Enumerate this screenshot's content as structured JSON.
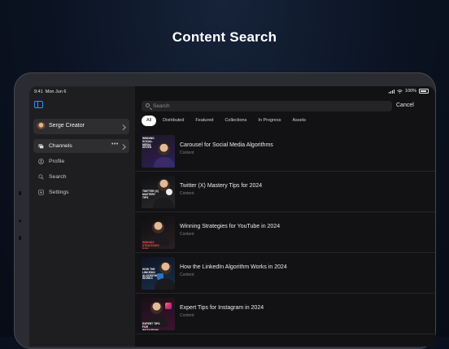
{
  "headline": "Content Search",
  "status_bar": {
    "time": "9:41",
    "date": "Mon Jun 6",
    "battery": "100%"
  },
  "sidebar": {
    "account": {
      "name": "Serge Creator"
    },
    "items": [
      {
        "label": "Channels",
        "icon": "folders-icon",
        "active": true,
        "more": "•••"
      },
      {
        "label": "Profile",
        "icon": "person-circle-icon"
      },
      {
        "label": "Search",
        "icon": "search-icon"
      },
      {
        "label": "Settings",
        "icon": "gear-icon"
      }
    ]
  },
  "search": {
    "placeholder": "Search",
    "value": "",
    "cancel_label": "Cancel"
  },
  "tabs": [
    "All",
    "Distributed",
    "Featured",
    "Collections",
    "In Progress",
    "Assets"
  ],
  "active_tab": "All",
  "results": [
    {
      "title": "Carousel for Social Media Algorithms",
      "subtitle": "Content",
      "thumb_text": "WINNING SOCIAL MEDIA SEVEN"
    },
    {
      "title": "Twitter (X) Mastery Tips for 2024",
      "subtitle": "Content",
      "thumb_text": "TWITTER (X) MASTERY TIPS"
    },
    {
      "title": "Winning Strategies for YouTube in 2024",
      "subtitle": "Content",
      "thumb_text": "WINNING STRATEGIES FOR YOUTUBE"
    },
    {
      "title": "How the LinkedIn Algorithm Works in 2024",
      "subtitle": "Content",
      "thumb_text": "HOW THE LINKEDIN ALGORITHM WORKS"
    },
    {
      "title": "Expert Tips for Instagram in 2024",
      "subtitle": "Content",
      "thumb_text": "EXPERT TIPS FOR INSTAGRAM"
    }
  ],
  "colors": {
    "accent": "#3d8bff",
    "background": "#121214",
    "sidebar": "#1e1e20"
  }
}
